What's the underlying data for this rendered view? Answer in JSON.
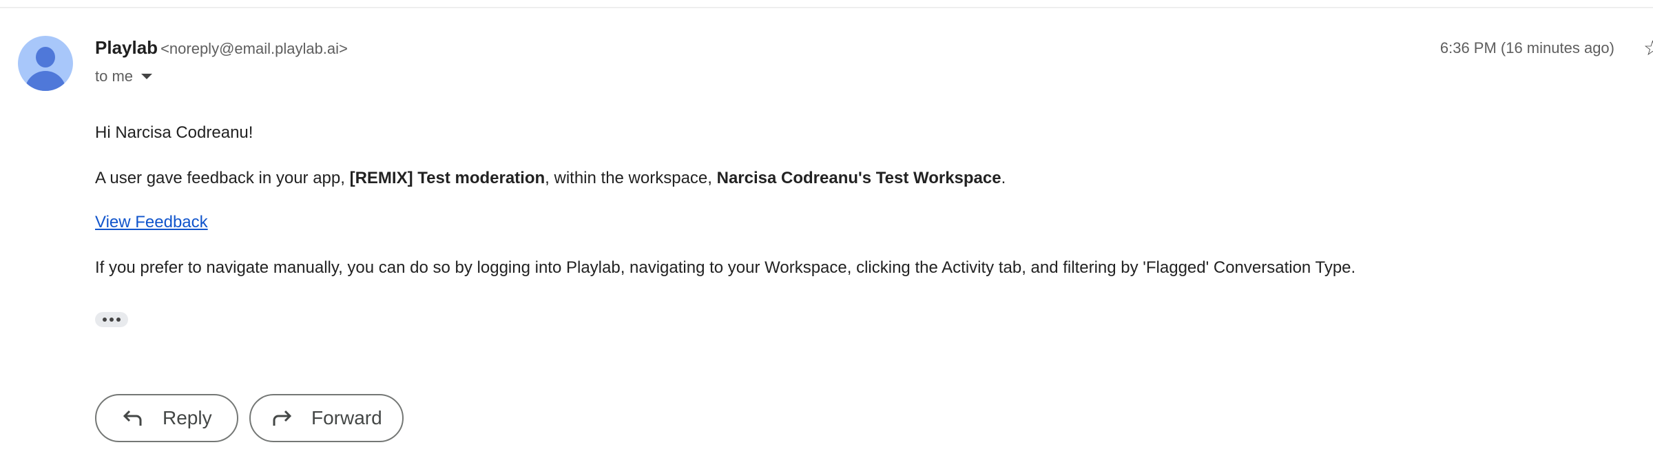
{
  "sender": {
    "name": "Playlab",
    "email": "<noreply@email.playlab.ai>",
    "recipient_label": "to me"
  },
  "timestamp": "6:36 PM (16 minutes ago)",
  "icons": {
    "avatar": "person-avatar-icon",
    "caret": "caret-down-icon",
    "star": "star-icon",
    "reply": "reply-arrow-icon",
    "forward": "forward-arrow-icon",
    "more": "ellipsis-icon"
  },
  "colors": {
    "avatar_bg": "#a8c7fa",
    "avatar_fg": "#4f78d9",
    "link": "#1155cc"
  },
  "body": {
    "greeting": "Hi Narcisa Codreanu!",
    "line1_prefix": "A user gave feedback in your app, ",
    "app_name": "[REMIX] Test moderation",
    "line1_middle": ", within the workspace, ",
    "workspace_name": "Narcisa Codreanu's Test Workspace",
    "line1_suffix": ".",
    "link_text": "View Feedback",
    "line2": "If you prefer to navigate manually, you can do so by logging into Playlab, navigating to your Workspace, clicking the Activity tab, and filtering by 'Flagged' Conversation Type."
  },
  "actions": {
    "reply": "Reply",
    "forward": "Forward"
  }
}
